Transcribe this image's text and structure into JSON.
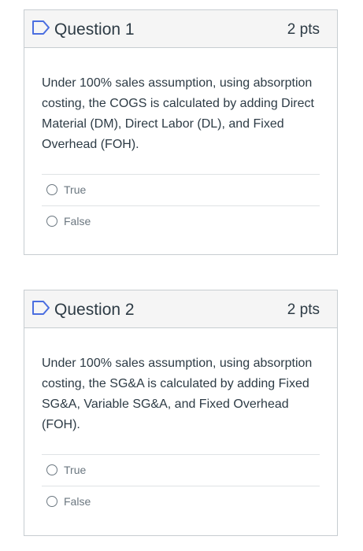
{
  "questions": [
    {
      "title": "Question 1",
      "points": "2 pts",
      "text": "Under 100% sales assumption,  using absorption costing, the COGS is calculated by adding Direct Material (DM), Direct Labor (DL), and Fixed Overhead (FOH).",
      "answers": [
        "True",
        "False"
      ],
      "flag_icon": "flag-outline-icon",
      "flag_color": "#4a6ee0"
    },
    {
      "title": "Question 2",
      "points": "2 pts",
      "text": "Under 100% sales assumption,  using absorption costing, the SG&A is calculated by adding Fixed SG&A, Variable SG&A, and Fixed Overhead (FOH).",
      "answers": [
        "True",
        "False"
      ],
      "flag_icon": "flag-outline-icon",
      "flag_color": "#4a6ee0"
    }
  ]
}
